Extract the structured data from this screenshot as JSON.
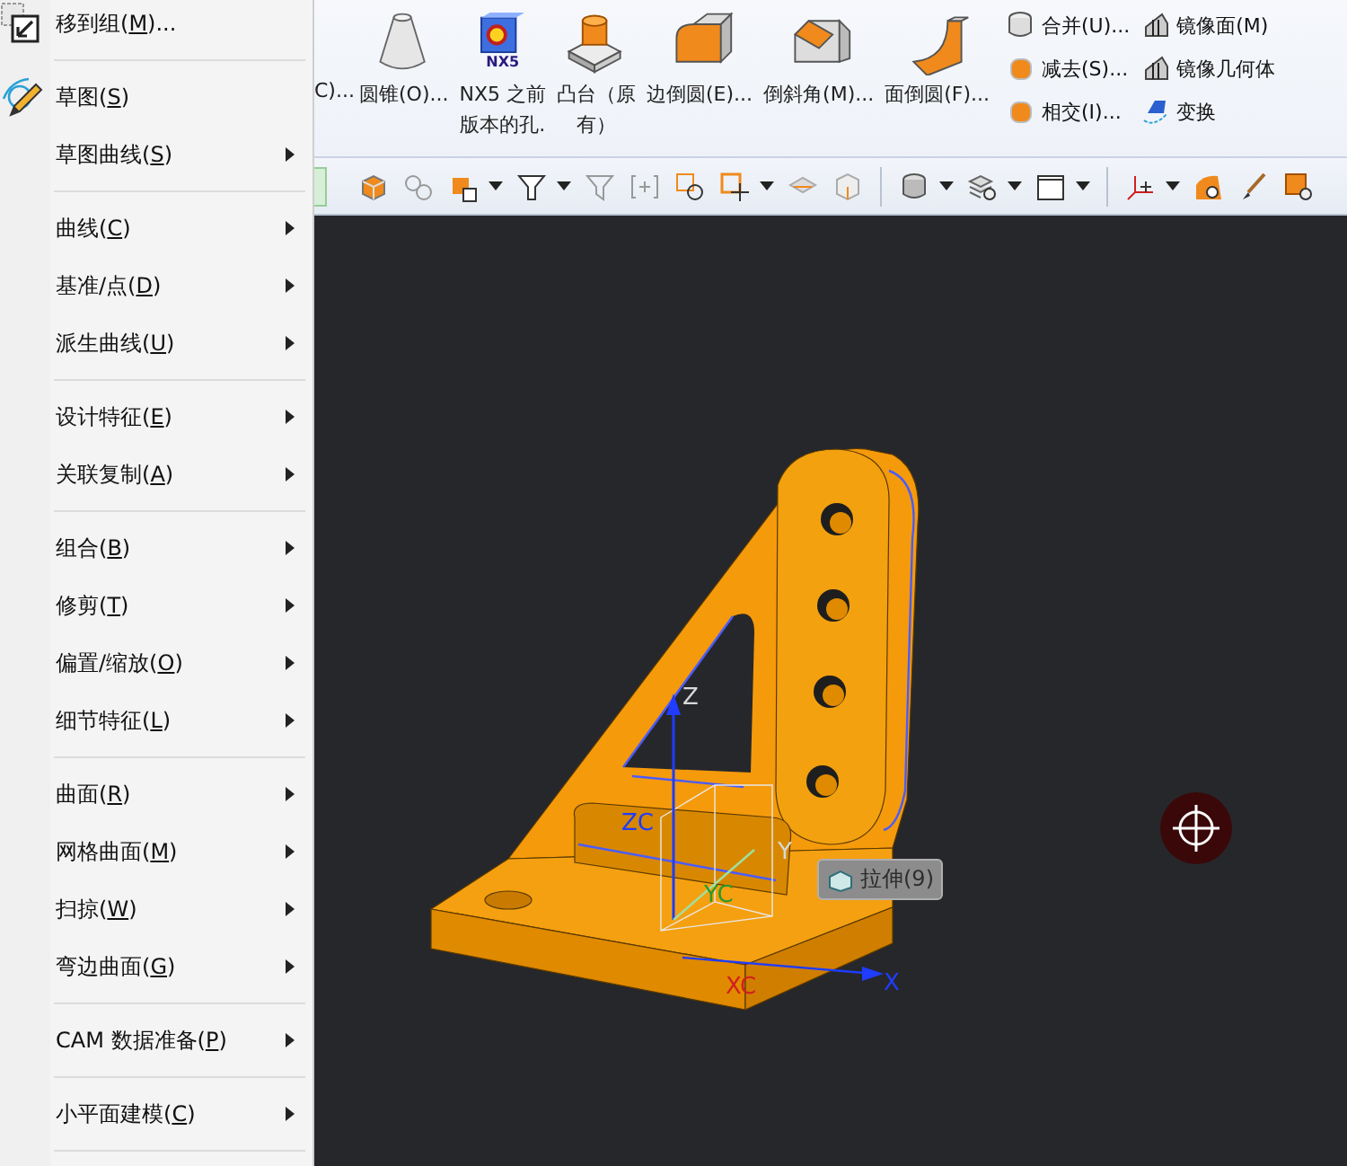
{
  "context_menu": {
    "items": [
      {
        "kind": "item",
        "before": "移到组(",
        "key": "M",
        "after": ")...",
        "submenu": false
      },
      {
        "kind": "separator"
      },
      {
        "kind": "item",
        "before": "草图(",
        "key": "S",
        "after": ")",
        "submenu": false
      },
      {
        "kind": "item",
        "before": "草图曲线(",
        "key": "S",
        "after": ")",
        "submenu": true
      },
      {
        "kind": "separator"
      },
      {
        "kind": "item",
        "before": "曲线(",
        "key": "C",
        "after": ")",
        "submenu": true
      },
      {
        "kind": "item",
        "before": "基准/点(",
        "key": "D",
        "after": ")",
        "submenu": true
      },
      {
        "kind": "item",
        "before": "派生曲线(",
        "key": "U",
        "after": ")",
        "submenu": true
      },
      {
        "kind": "separator"
      },
      {
        "kind": "item",
        "before": "设计特征(",
        "key": "E",
        "after": ")",
        "submenu": true
      },
      {
        "kind": "item",
        "before": "关联复制(",
        "key": "A",
        "after": ")",
        "submenu": true
      },
      {
        "kind": "separator"
      },
      {
        "kind": "item",
        "before": "组合(",
        "key": "B",
        "after": ")",
        "submenu": true
      },
      {
        "kind": "item",
        "before": "修剪(",
        "key": "T",
        "after": ")",
        "submenu": true
      },
      {
        "kind": "item",
        "before": "偏置/缩放(",
        "key": "O",
        "after": ")",
        "submenu": true
      },
      {
        "kind": "item",
        "before": "细节特征(",
        "key": "L",
        "after": ")",
        "submenu": true
      },
      {
        "kind": "separator"
      },
      {
        "kind": "item",
        "before": "曲面(",
        "key": "R",
        "after": ")",
        "submenu": true
      },
      {
        "kind": "item",
        "before": "网格曲面(",
        "key": "M",
        "after": ")",
        "submenu": true
      },
      {
        "kind": "item",
        "before": "扫掠(",
        "key": "W",
        "after": ")",
        "submenu": true
      },
      {
        "kind": "item",
        "before": "弯边曲面(",
        "key": "G",
        "after": ")",
        "submenu": true
      },
      {
        "kind": "separator"
      },
      {
        "kind": "item",
        "before": "CAM 数据准备(",
        "key": "P",
        "after": ")",
        "submenu": true
      },
      {
        "kind": "separator"
      },
      {
        "kind": "item",
        "before": "小平面建模(",
        "key": "C",
        "after": ")",
        "submenu": true
      },
      {
        "kind": "separator"
      }
    ]
  },
  "ribbon": {
    "large_buttons": [
      {
        "kind": "cut",
        "label": "C)..."
      },
      {
        "kind": "cone",
        "label": "圆锥(O)..."
      },
      {
        "kind": "hole",
        "lines": [
          "NX5 之前",
          "版本的孔."
        ],
        "badge": "NX5"
      },
      {
        "kind": "boss",
        "lines": [
          "凸台（原",
          "有）"
        ]
      },
      {
        "kind": "edge-blend",
        "label": "边倒圆(E)..."
      },
      {
        "kind": "chamfer",
        "label": "倒斜角(M)..."
      },
      {
        "kind": "face-blend",
        "label": "面倒圆(F)..."
      }
    ],
    "small_columns": [
      [
        {
          "label": "合并(U)..."
        },
        {
          "label": "减去(S)..."
        },
        {
          "label": "相交(I)..."
        }
      ],
      [
        {
          "label": "镜像面(M)"
        },
        {
          "label": "镜像几何体"
        },
        {
          "label": "变换"
        }
      ]
    ]
  },
  "viewport": {
    "axis_labels": [
      {
        "text": "ZC",
        "color": "#1f3cff"
      },
      {
        "text": "YC",
        "color": "#2a9a2a"
      },
      {
        "text": "XC",
        "color": "#d02020"
      },
      {
        "text": "X",
        "color": "#1f3cff"
      },
      {
        "text": "Y",
        "color": "#d8d8d8"
      },
      {
        "text": "Z",
        "color": "#d8d8d8"
      }
    ],
    "tooltip": {
      "label": "拉伸(9)"
    }
  }
}
